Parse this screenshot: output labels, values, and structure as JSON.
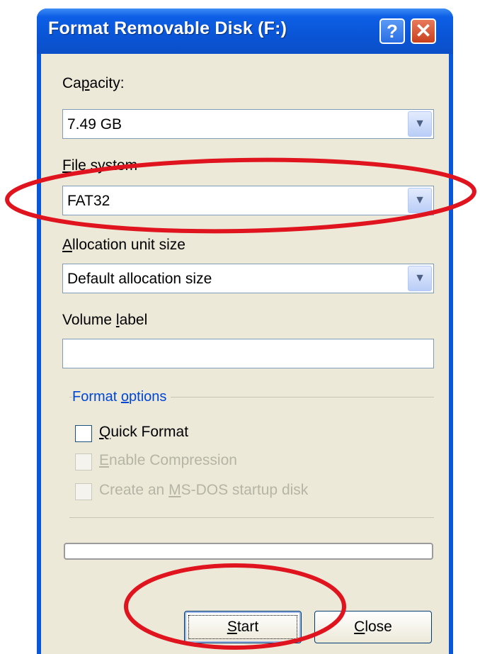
{
  "window": {
    "title": "Format Removable Disk (F:)",
    "help_glyph": "?",
    "close_glyph": "✕"
  },
  "capacity": {
    "label_pre": "Ca",
    "label_u": "p",
    "label_post": "acity:",
    "value": "7.49 GB"
  },
  "file_system": {
    "label_u": "F",
    "label_post": "ile system",
    "value": "FAT32"
  },
  "allocation": {
    "label_u": "A",
    "label_post": "llocation unit size",
    "value": "Default allocation size"
  },
  "volume_label": {
    "label_pre": "Volume ",
    "label_u": "l",
    "label_post": "abel",
    "value": ""
  },
  "format_options": {
    "title_pre": "Format ",
    "title_u": "o",
    "title_post": "ptions",
    "quick_format": {
      "u": "Q",
      "rest": "uick Format",
      "checked": false,
      "enabled": true
    },
    "enable_compression": {
      "u": "E",
      "rest": "nable Compression",
      "checked": false,
      "enabled": false
    },
    "msdos": {
      "pre": "Create an ",
      "u": "M",
      "rest": "S-DOS startup disk",
      "checked": false,
      "enabled": false
    }
  },
  "progress": 0,
  "buttons": {
    "start": {
      "u": "S",
      "rest": "tart"
    },
    "close": {
      "u": "C",
      "rest": "lose"
    }
  },
  "colors": {
    "titlebar": "#0a55d6",
    "dialog_bg": "#ece9d8",
    "annotation": "#e0141e",
    "group_title": "#0046d5"
  }
}
